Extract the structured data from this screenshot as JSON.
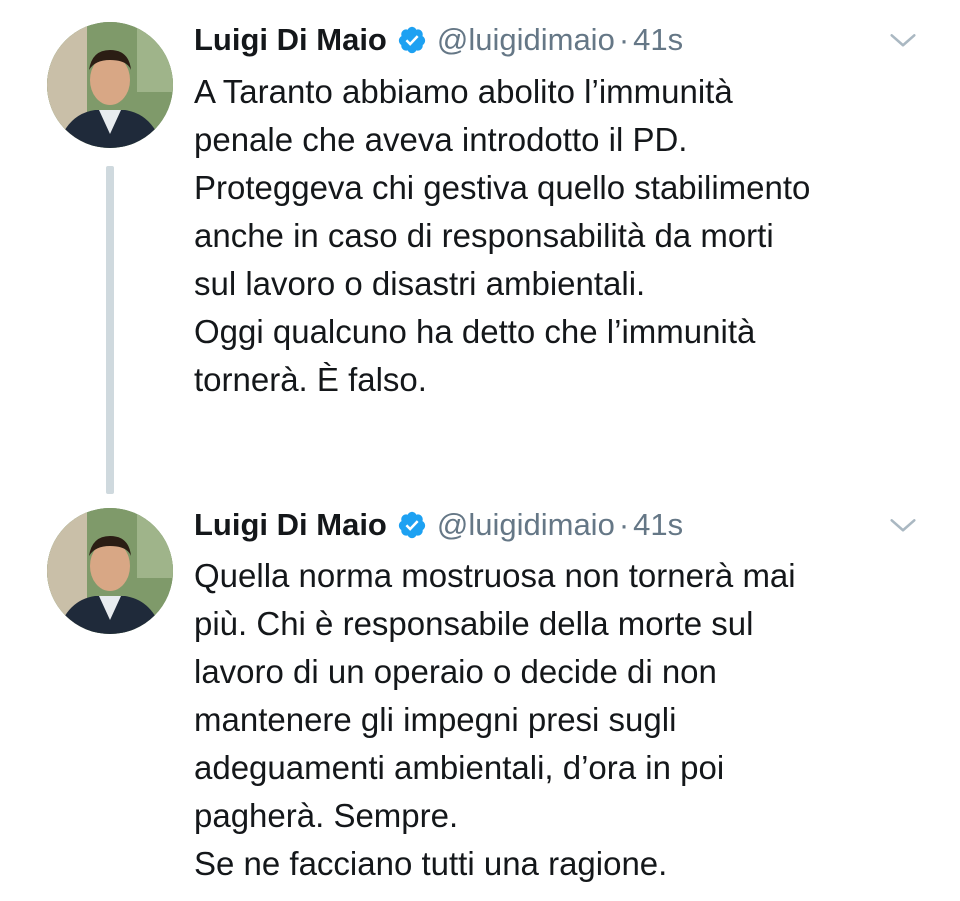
{
  "tweets": [
    {
      "author_name": "Luigi Di Maio",
      "handle": "@luigidimaio",
      "separator": "·",
      "time": "41s",
      "text_lines": [
        "A Taranto abbiamo abolito l’immunità",
        "penale che aveva introdotto il PD.",
        "Proteggeva chi gestiva quello stabilimento",
        "anche in caso di responsabilità da morti",
        "sul lavoro o disastri ambientali.",
        "Oggi qualcuno ha detto che l’immunità",
        "tornerà. È falso."
      ]
    },
    {
      "author_name": "Luigi Di Maio",
      "handle": "@luigidimaio",
      "separator": "·",
      "time": "41s",
      "text_lines": [
        "Quella norma mostruosa non tornerà mai",
        "più. Chi è responsabile della morte sul",
        "lavoro di un operaio o decide di non",
        "mantenere gli impegni presi sugli",
        "adeguamenti ambientali, d’ora in poi",
        "pagherà. Sempre.",
        "Se ne facciano tutti una ragione."
      ]
    }
  ],
  "icons": {
    "verified": "verified-badge-icon",
    "menu": "chevron-down-icon"
  },
  "colors": {
    "text": "#14171a",
    "secondary": "#657786",
    "verified_blue": "#1da1f2",
    "thread_line": "#cfd9de"
  }
}
